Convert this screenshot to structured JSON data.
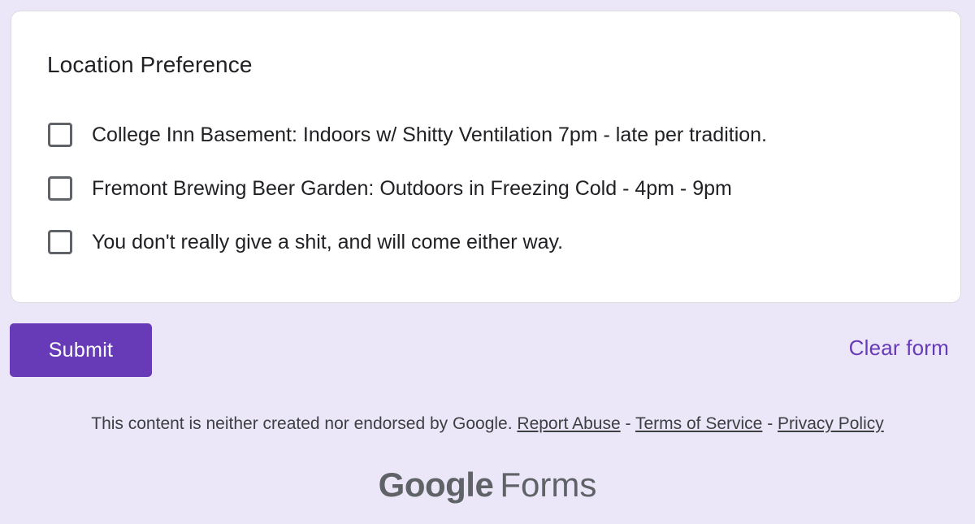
{
  "question": {
    "title": "Location Preference",
    "options": [
      {
        "label": "College Inn Basement: Indoors w/ Shitty Ventilation 7pm - late per tradition.",
        "checked": false
      },
      {
        "label": "Fremont Brewing Beer Garden: Outdoors in Freezing Cold - 4pm - 9pm",
        "checked": false
      },
      {
        "label": "You don't really give a shit, and will come either way.",
        "checked": false
      }
    ]
  },
  "actions": {
    "submit_label": "Submit",
    "clear_label": "Clear form"
  },
  "footer": {
    "disclaimer": "This content is neither created nor endorsed by Google.",
    "report_abuse": "Report Abuse",
    "terms": "Terms of Service",
    "privacy": "Privacy Policy",
    "separator": "-"
  },
  "brand": {
    "google": "Google",
    "forms": "Forms"
  },
  "colors": {
    "background": "#ece7f8",
    "accent": "#673ab7",
    "text": "#202124",
    "muted": "#5f6368"
  },
  "icons": {
    "checkbox": "checkbox-unchecked-icon"
  }
}
